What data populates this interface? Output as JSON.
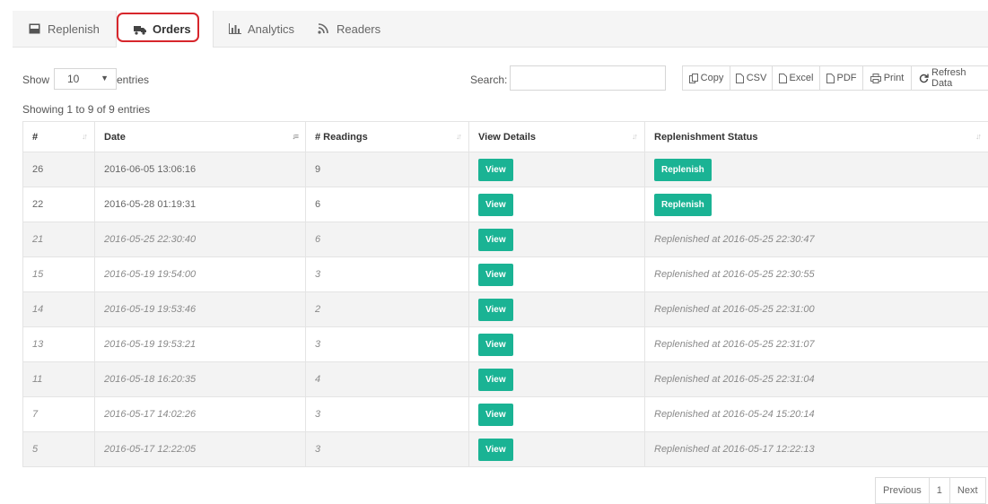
{
  "tabs": [
    {
      "label": "Replenish",
      "icon": "inbox-tray-icon"
    },
    {
      "label": "Orders",
      "icon": "truck-icon",
      "active": true
    },
    {
      "label": "Analytics",
      "icon": "bar-chart-icon"
    },
    {
      "label": "Readers",
      "icon": "rss-icon"
    }
  ],
  "length_menu": {
    "show_label": "Show",
    "value": "10",
    "entries_label": "entries"
  },
  "search": {
    "label": "Search:",
    "value": "",
    "placeholder": ""
  },
  "export_buttons": {
    "copy": "Copy",
    "csv": "CSV",
    "excel": "Excel",
    "pdf": "PDF",
    "print": "Print",
    "refresh": "Refresh Data"
  },
  "info": "Showing 1 to 9 of 9 entries",
  "table": {
    "columns": [
      "#",
      "Date",
      "# Readings",
      "View Details",
      "Replenishment Status"
    ],
    "view_label": "View",
    "replenish_label": "Replenish",
    "rows": [
      {
        "id": "26",
        "date": "2016-06-05 13:06:16",
        "readings": "9",
        "status": ""
      },
      {
        "id": "22",
        "date": "2016-05-28 01:19:31",
        "readings": "6",
        "status": ""
      },
      {
        "id": "21",
        "date": "2016-05-25 22:30:40",
        "readings": "6",
        "status": "Replenished at 2016-05-25 22:30:47"
      },
      {
        "id": "15",
        "date": "2016-05-19 19:54:00",
        "readings": "3",
        "status": "Replenished at 2016-05-25 22:30:55"
      },
      {
        "id": "14",
        "date": "2016-05-19 19:53:46",
        "readings": "2",
        "status": "Replenished at 2016-05-25 22:31:00"
      },
      {
        "id": "13",
        "date": "2016-05-19 19:53:21",
        "readings": "3",
        "status": "Replenished at 2016-05-25 22:31:07"
      },
      {
        "id": "11",
        "date": "2016-05-18 16:20:35",
        "readings": "4",
        "status": "Replenished at 2016-05-25 22:31:04"
      },
      {
        "id": "7",
        "date": "2016-05-17 14:02:26",
        "readings": "3",
        "status": "Replenished at 2016-05-24 15:20:14"
      },
      {
        "id": "5",
        "date": "2016-05-17 12:22:05",
        "readings": "3",
        "status": "Replenished at 2016-05-17 12:22:13"
      }
    ]
  },
  "pagination": {
    "previous": "Previous",
    "page": "1",
    "next": "Next"
  },
  "colors": {
    "accent": "#1ab394",
    "highlight": "#d7262c"
  }
}
